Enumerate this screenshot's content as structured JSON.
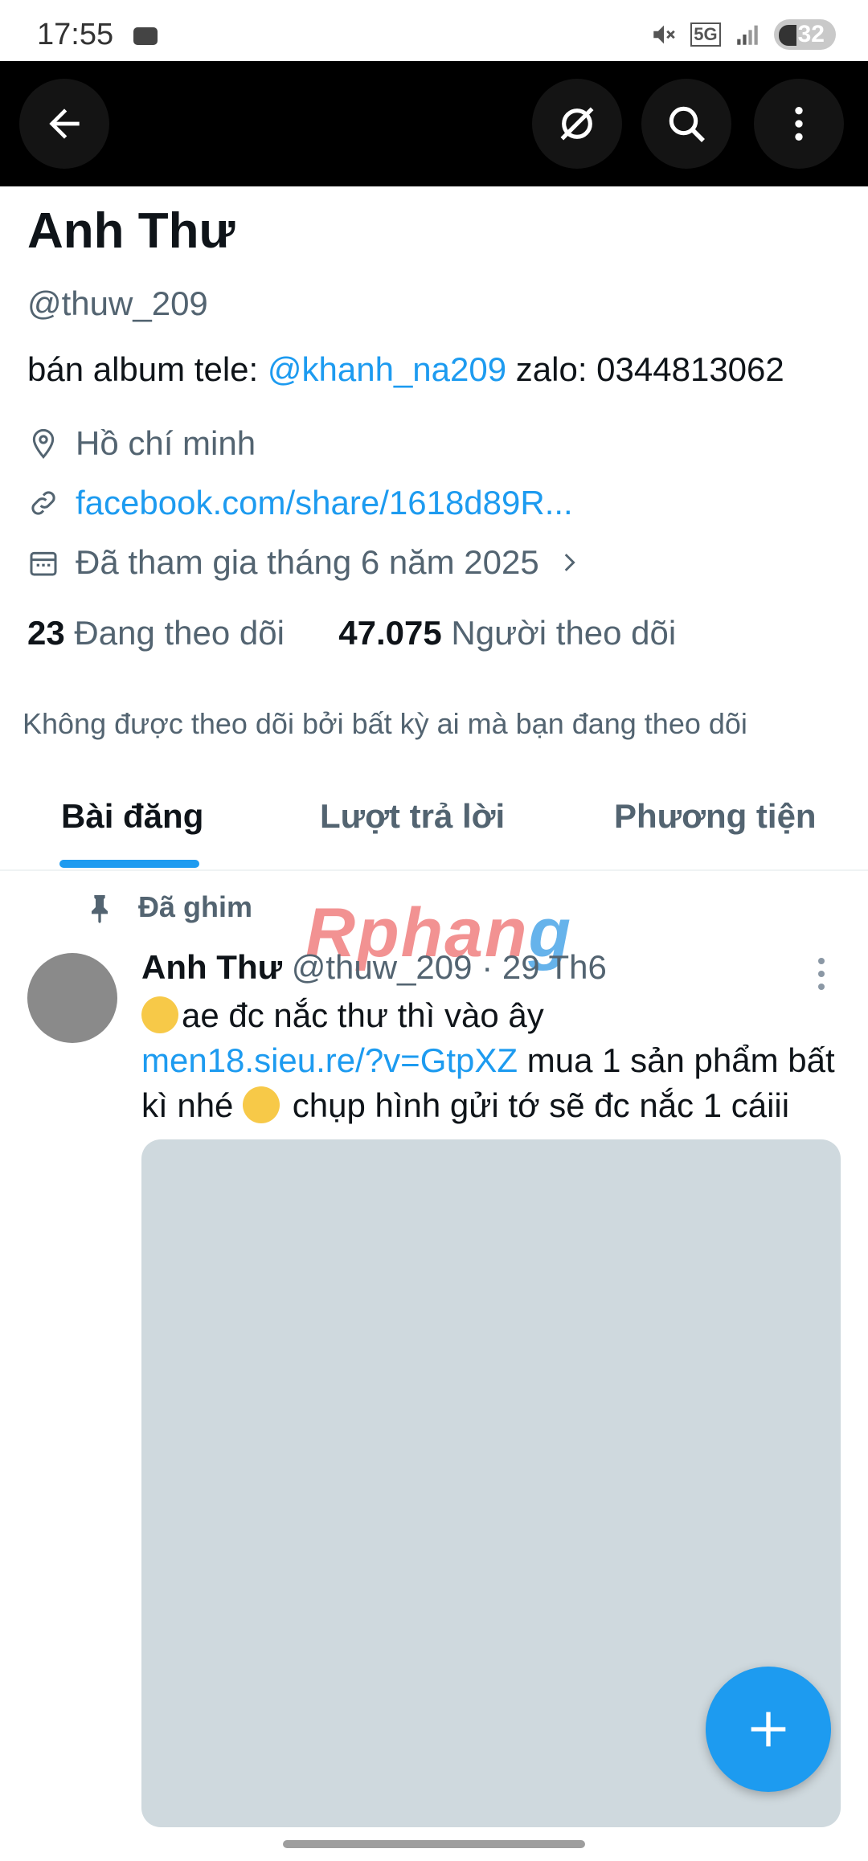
{
  "status_bar": {
    "time": "17:55",
    "network": "5G",
    "battery": "32"
  },
  "profile": {
    "display_name": "Anh Thư",
    "handle": "@thuw_209",
    "bio_prefix": "bán album tele: ",
    "bio_mention": "@khanh_na209",
    "bio_suffix": " zalo: 0344813062",
    "location": "Hồ chí minh",
    "website": "facebook.com/share/1618d89R...",
    "joined": "Đã tham gia tháng 6 năm 2025",
    "following_count": "23",
    "following_label": "Đang theo dõi",
    "followers_count": "47.075",
    "followers_label": "Người theo dõi",
    "follow_note": "Không được theo dõi bởi bất kỳ ai mà bạn đang theo dõi"
  },
  "tabs": [
    {
      "label": "Bài đăng"
    },
    {
      "label": "Lượt trả lời"
    },
    {
      "label": "Phương tiện"
    }
  ],
  "watermark": {
    "part1": "Rphan",
    "part2": "g"
  },
  "pinned_post": {
    "pinned_label": "Đã ghim",
    "author": "Anh Thư",
    "handle": "@thuw_209",
    "date": "· 29 Th6",
    "text_line1": "ae đc nắc thư thì vào ây",
    "link": "men18.sieu.re/?v=GtpXZ",
    "text_line2": " mua 1 sản phẩm bất kì nhé ",
    "text_line3": " chụp hình gửi tớ sẽ đc nắc 1 cáiii"
  },
  "icons": {
    "back": "arrow-left-icon",
    "grok": "grok-icon",
    "search": "search-icon",
    "more": "more-vertical-icon",
    "location": "location-pin-icon",
    "link": "link-icon",
    "calendar": "calendar-icon",
    "pin": "pin-icon",
    "compose": "plus-icon"
  },
  "colors": {
    "accent": "#1d9bf0",
    "text": "#0f1419",
    "secondary": "#536471"
  }
}
